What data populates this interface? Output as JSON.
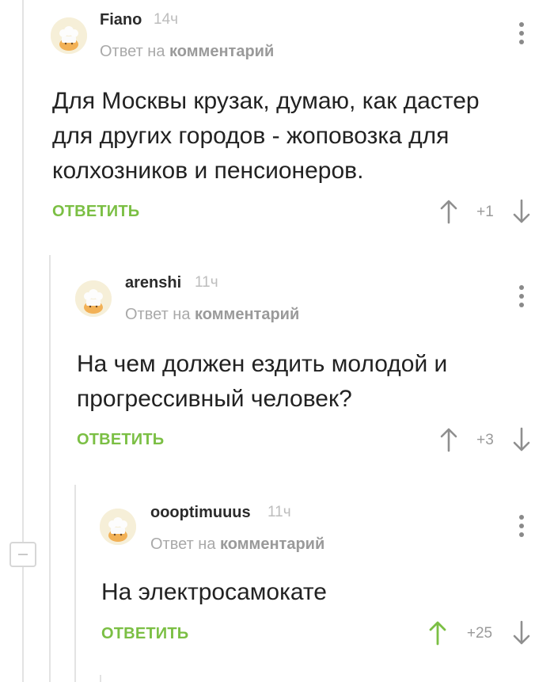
{
  "ui": {
    "reply_to_prefix": "Ответ на",
    "reply_to_target": "комментарий",
    "reply_label": "ОТВЕТИТЬ",
    "colors": {
      "accent_green": "#7bbf44",
      "muted": "#9a9a9a",
      "thread_line": "#e3e3e3"
    },
    "icons": [
      "chef-hat-avatar-icon",
      "more-vertical-icon",
      "arrow-up-icon",
      "arrow-down-icon",
      "collapse-thread-icon"
    ]
  },
  "comments": [
    {
      "author": "Fiano",
      "time": "14ч",
      "text_lines": [
        "Для Москвы крузак, думаю, как дастер",
        "для других городов - жоповозка для",
        "колхозников и пенсионеров."
      ],
      "score": "+1",
      "upvoted": false
    },
    {
      "author": "arenshi",
      "time": "11ч",
      "text_lines": [
        "На чем должен ездить молодой и",
        "прогрессивный человек?"
      ],
      "score": "+3",
      "upvoted": false
    },
    {
      "author": "oooptimuuus",
      "time": "11ч",
      "text_lines": [
        "На электросамокате"
      ],
      "score": "+25",
      "upvoted": true
    }
  ]
}
